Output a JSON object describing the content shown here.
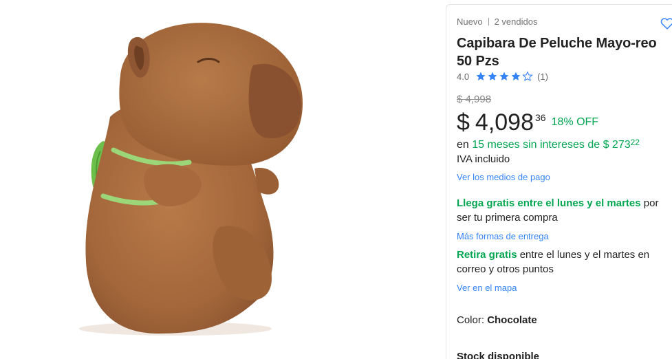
{
  "product": {
    "condition": "Nuevo",
    "sold": "2 vendidos",
    "title": "Capibara De Peluche Mayo-reo 50 Pzs",
    "rating_value": "4.0",
    "rating": 4,
    "rating_max": 5,
    "review_count": "(1)",
    "original_price": "$ 4,998",
    "price_currency": "$",
    "price_amount": "4,098",
    "price_cents": "36",
    "discount": "18% OFF",
    "installments_prefix": "en",
    "installments_plan": "15 meses sin intereses de $ 273",
    "installments_cents": "22",
    "tax_note": "IVA incluido",
    "payment_link": "Ver los medios de pago",
    "shipping": {
      "headline": "Llega gratis entre el lunes y el martes",
      "rest": "por ser tu primera compra",
      "link": "Más formas de entrega"
    },
    "pickup": {
      "headline": "Retira gratis",
      "rest": "entre el lunes y el martes en correo y otros puntos",
      "link": "Ver en el mapa"
    },
    "color_label": "Color:",
    "color_value": "Chocolate",
    "stock": "Stock disponible"
  },
  "icons": {
    "favorite": "heart-outline-icon",
    "star": "star-icon"
  },
  "colors": {
    "accent_blue": "#3483fa",
    "green": "#00a650",
    "plush_brown": "#a86a3d",
    "turtle_green": "#6cbf4a"
  }
}
